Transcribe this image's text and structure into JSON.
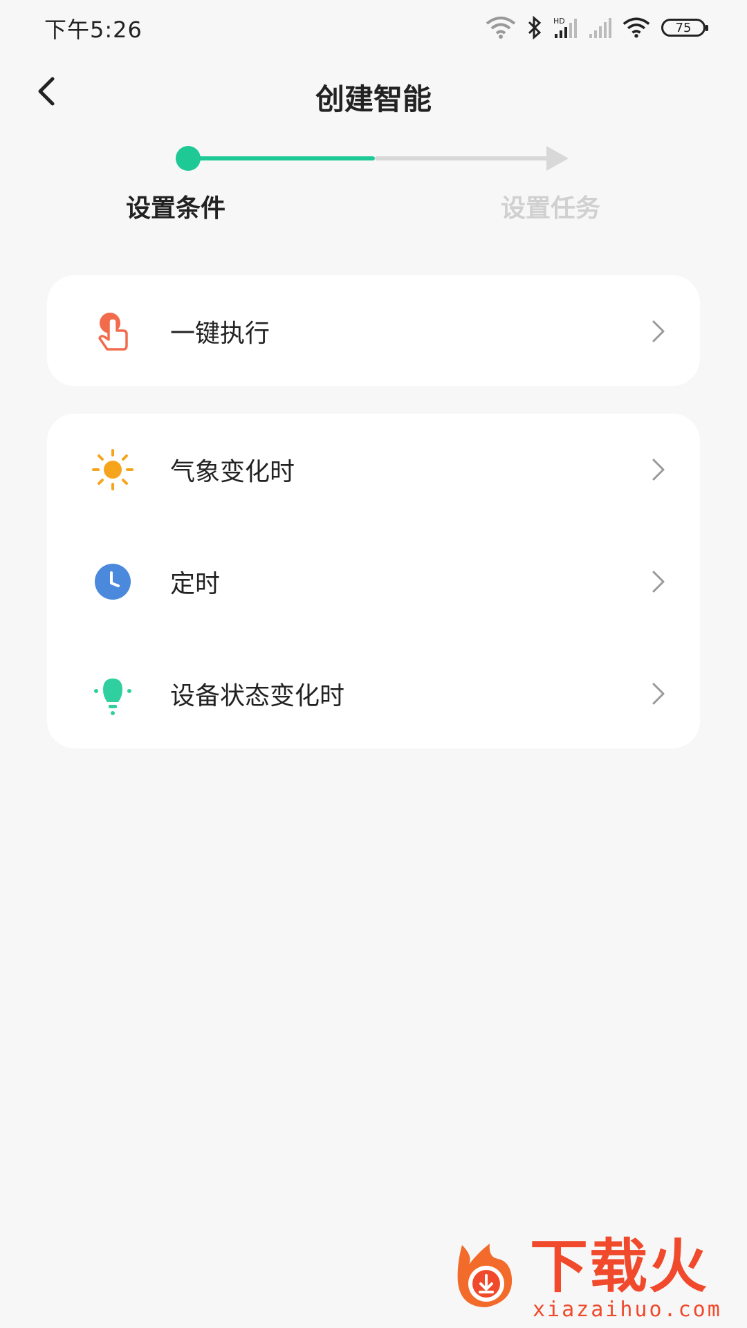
{
  "status_bar": {
    "time": "下午5:26",
    "battery": "75",
    "icons": [
      "wifi-icon",
      "bluetooth-icon",
      "hd-signal-icon",
      "signal-icon",
      "wifi-icon"
    ]
  },
  "header": {
    "title": "创建智能",
    "back_icon": "back-arrow-icon"
  },
  "stepper": {
    "steps": [
      {
        "label": "设置条件",
        "active": true
      },
      {
        "label": "设置任务",
        "active": false
      }
    ],
    "accent": "#1ec996",
    "inactive": "#d8d8d8"
  },
  "conditions": {
    "card1": [
      {
        "label": "一键执行",
        "icon": "tap-hand-icon",
        "color": "#f26b4c"
      }
    ],
    "card2": [
      {
        "label": "气象变化时",
        "icon": "sun-icon",
        "color": "#f7a41d"
      },
      {
        "label": "定时",
        "icon": "clock-icon",
        "color": "#4a89dc"
      },
      {
        "label": "设备状态变化时",
        "icon": "bulb-icon",
        "color": "#2fcf9f"
      }
    ]
  },
  "watermark": {
    "text": "下载火",
    "url": "xiazaihuo.com",
    "color": "#f0492b"
  }
}
